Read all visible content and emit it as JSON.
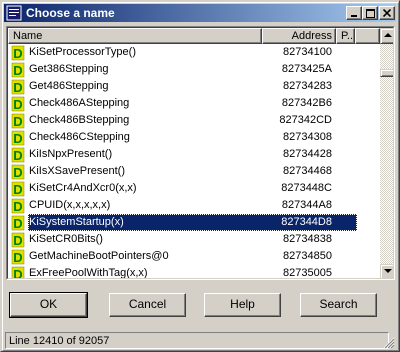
{
  "window": {
    "title": "Choose a name"
  },
  "listview": {
    "columns": {
      "name": "Name",
      "address": "Address",
      "p": "P..."
    },
    "rows": [
      {
        "type_icon": "D",
        "name": "KiSetProcessorType()",
        "address": "82734100",
        "selected": false
      },
      {
        "type_icon": "D",
        "name": "Get386Stepping",
        "address": "8273425A",
        "selected": false
      },
      {
        "type_icon": "D",
        "name": "Get486Stepping",
        "address": "82734283",
        "selected": false
      },
      {
        "type_icon": "D",
        "name": "Check486AStepping",
        "address": "827342B6",
        "selected": false
      },
      {
        "type_icon": "D",
        "name": "Check486BStepping",
        "address": "827342CD",
        "selected": false
      },
      {
        "type_icon": "D",
        "name": "Check486CStepping",
        "address": "82734308",
        "selected": false
      },
      {
        "type_icon": "D",
        "name": "KiIsNpxPresent()",
        "address": "82734428",
        "selected": false
      },
      {
        "type_icon": "D",
        "name": "KiIsXSavePresent()",
        "address": "82734468",
        "selected": false
      },
      {
        "type_icon": "D",
        "name": "KiSetCr4AndXcr0(x,x)",
        "address": "8273448C",
        "selected": false
      },
      {
        "type_icon": "D",
        "name": "CPUID(x,x,x,x,x)",
        "address": "827344A8",
        "selected": false
      },
      {
        "type_icon": "D",
        "name": "KiSystemStartup(x)",
        "address": "827344D8",
        "selected": true
      },
      {
        "type_icon": "D",
        "name": "KiSetCR0Bits()",
        "address": "82734838",
        "selected": false
      },
      {
        "type_icon": "D",
        "name": "GetMachineBootPointers@0",
        "address": "82734850",
        "selected": false
      },
      {
        "type_icon": "D",
        "name": "ExFreePoolWithTag(x,x)",
        "address": "82735005",
        "selected": false
      }
    ]
  },
  "buttons": {
    "ok": "OK",
    "cancel": "Cancel",
    "help": "Help",
    "search": "Search"
  },
  "status": {
    "text": "Line 12410 of 92057"
  },
  "colors": {
    "selection": "#0a246a",
    "icon_fill": "#e0e000",
    "icon_letter": "#008000"
  },
  "icons": {
    "titlebar": "window-app-icon",
    "row_type": "function-d-icon",
    "minimize": "minimize-icon",
    "maximize": "maximize-icon",
    "close": "close-icon",
    "scroll_up": "scroll-up-arrow-icon",
    "scroll_down": "scroll-down-arrow-icon"
  }
}
